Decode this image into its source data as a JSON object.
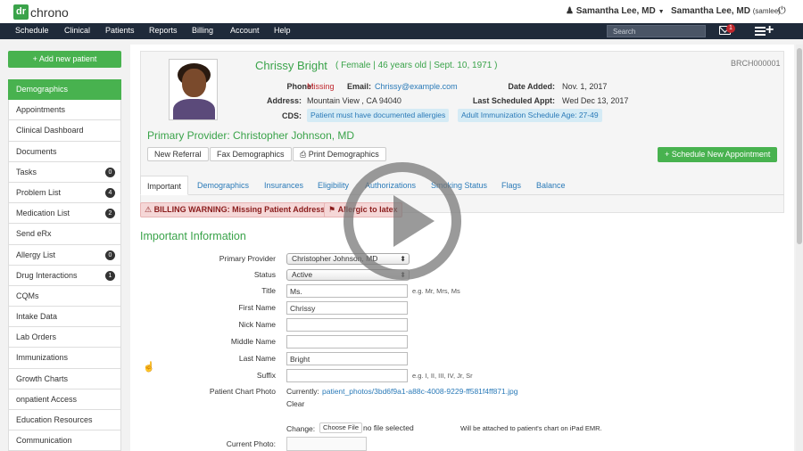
{
  "header": {
    "logo_box": "dr",
    "logo_text": "chrono",
    "user_menu": "Samantha Lee, MD",
    "user_right_name": "Samantha Lee, MD",
    "user_right_handle": "(samlee)"
  },
  "nav": {
    "items": [
      "Schedule",
      "Clinical",
      "Patients",
      "Reports",
      "Billing",
      "Account",
      "Help"
    ],
    "search_placeholder": "Search",
    "mail_count": "1"
  },
  "sidebar": {
    "add_button": "+ Add new patient",
    "items": [
      {
        "label": "Demographics",
        "count": ""
      },
      {
        "label": "Appointments",
        "count": ""
      },
      {
        "label": "Clinical Dashboard",
        "count": ""
      },
      {
        "label": "Documents",
        "count": ""
      },
      {
        "label": "Tasks",
        "count": "0"
      },
      {
        "label": "Problem List",
        "count": "4"
      },
      {
        "label": "Medication List",
        "count": "2"
      },
      {
        "label": "Send eRx",
        "count": ""
      },
      {
        "label": "Allergy List",
        "count": "0"
      },
      {
        "label": "Drug Interactions",
        "count": "1"
      },
      {
        "label": "CQMs",
        "count": ""
      },
      {
        "label": "Intake Data",
        "count": ""
      },
      {
        "label": "Lab Orders",
        "count": ""
      },
      {
        "label": "Immunizations",
        "count": ""
      },
      {
        "label": "Growth Charts",
        "count": ""
      },
      {
        "label": "onpatient Access",
        "count": ""
      },
      {
        "label": "Education Resources",
        "count": ""
      },
      {
        "label": "Communication",
        "count": ""
      }
    ]
  },
  "patient": {
    "name": "Chrissy Bright",
    "meta": "( Female | 46 years old | Sept. 10, 1971 )",
    "id": "BRCH000001",
    "phone_label": "Phone:",
    "phone": "Missing",
    "email_label": "Email:",
    "email": "Chrissy@example.com",
    "address_label": "Address:",
    "address": "Mountain View , CA 94040",
    "date_added_label": "Date Added:",
    "date_added": "Nov. 1, 2017",
    "last_appt_label": "Last Scheduled Appt:",
    "last_appt": "Wed Dec 13, 2017",
    "cds_label": "CDS:",
    "cds_tags": [
      "Patient must have documented allergies",
      "Adult Immunization Schedule Age: 27-49"
    ],
    "primary_provider": "Primary Provider: Christopher Johnson, MD"
  },
  "actions": {
    "new_referral": "New Referral",
    "fax_demographics": "Fax Demographics",
    "print_demographics": "Print Demographics",
    "schedule_new": "+ Schedule New Appointment"
  },
  "tabs": [
    "Important",
    "Demographics",
    "Insurances",
    "Eligibility",
    "Authorizations",
    "Smoking Status",
    "Flags",
    "Balance"
  ],
  "warnings": {
    "billing": "BILLING WARNING: Missing Patient Address",
    "allergy": "Allergic to latex"
  },
  "form": {
    "section_title": "Important Information",
    "primary_provider_label": "Primary Provider",
    "primary_provider_value": "Christopher Johnson, MD",
    "status_label": "Status",
    "status_value": "Active",
    "title_label": "Title",
    "title_value": "Ms.",
    "title_hint": "e.g. Mr, Mrs, Ms",
    "first_name_label": "First Name",
    "first_name_value": "Chrissy",
    "nick_name_label": "Nick Name",
    "nick_name_value": "",
    "middle_name_label": "Middle Name",
    "middle_name_value": "",
    "last_name_label": "Last Name",
    "last_name_value": "Bright",
    "suffix_label": "Suffix",
    "suffix_value": "",
    "suffix_hint": "e.g. I, II, III, IV, Jr, Sr",
    "chart_photo_label": "Patient Chart Photo",
    "currently_label": "Currently:",
    "photo_path": "patient_photos/3bd6f9a1-a88c-4008-9229-ff581f4ff871.jpg",
    "clear_label": "Clear",
    "change_label": "Change:",
    "choose_file": "Choose File",
    "no_file": "no file selected",
    "attach_note": "Will be attached to patient's chart on iPad EMR.",
    "current_photo_label": "Current Photo:"
  },
  "colors": {
    "brand_green": "#48b24f",
    "nav_bg": "#1f2a3a",
    "link_blue": "#2a7ab8",
    "warning_red": "#c0272d"
  }
}
